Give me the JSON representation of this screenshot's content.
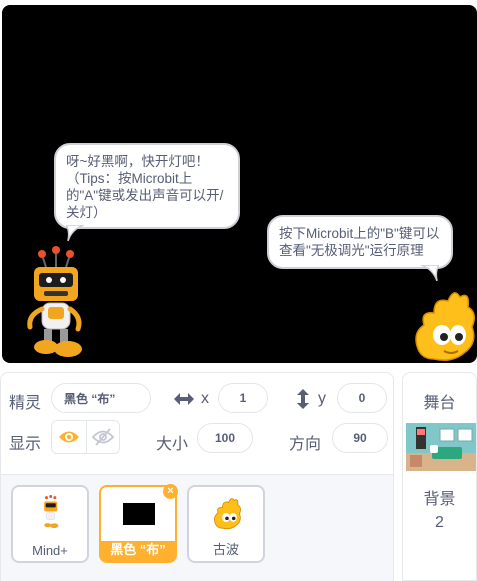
{
  "stage": {
    "bubble_left": "呀~好黑啊，快开灯吧！\n（Tips：按Microbit上\n的\"A\"键或发出声音可以开/\n关灯）",
    "bubble_right": "按下Microbit上的\"B\"键可以\n查看\"无极调光\"运行原理"
  },
  "sprite_info": {
    "sprite_label": "精灵",
    "sprite_name": "黑色 “布”",
    "x_label": "x",
    "x_value": "1",
    "y_label": "y",
    "y_value": "0",
    "show_label": "显示",
    "size_label": "大小",
    "size_value": "100",
    "direction_label": "方向",
    "direction_value": "90"
  },
  "sprites": [
    {
      "name": "Mind+",
      "icon": "robot-icon",
      "selected": false
    },
    {
      "name": "黑色 “布”",
      "icon": "black-rectangle",
      "selected": true
    },
    {
      "name": "古波",
      "icon": "gobo-icon",
      "selected": false
    }
  ],
  "stage_panel": {
    "title": "舞台",
    "backdrops_label": "背景",
    "backdrops_count": "2"
  },
  "colors": {
    "accent": "#ffb02e",
    "text": "#575e75",
    "stage_bg": "#000000"
  }
}
